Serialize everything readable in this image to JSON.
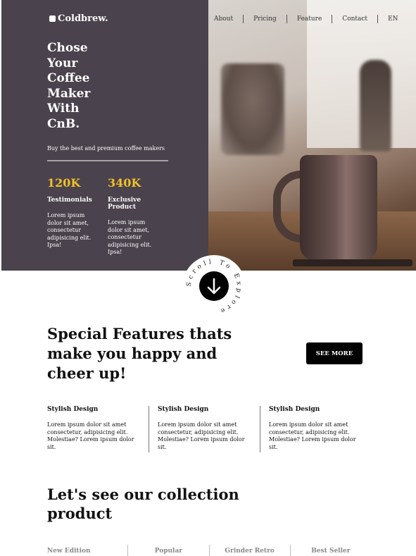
{
  "brand": {
    "name": "Coldbrew."
  },
  "nav": [
    "About",
    "Pricing",
    "Feature",
    "Contact",
    "EN"
  ],
  "hero": {
    "title_lines": [
      "Chose",
      "Your",
      "Coffee",
      "Maker",
      "With",
      "CnB."
    ],
    "subtitle": "Buy the best and premium coffee makers",
    "stats": [
      {
        "value": "120K",
        "label": "Testimonials",
        "desc": "Lorem ipsum dolor sit amet, consectetur adipisicing elit. Ipsa!"
      },
      {
        "value": "340K",
        "label": "Exclusive Product",
        "desc": "Lorem ipsum dolor sit amet, consectetur adipisicing elit. Ipsa!"
      }
    ],
    "scroll_text": "Scroll To Explore"
  },
  "features": {
    "title": "Special Features thats make you happy and cheer up!",
    "button": "SEE MORE",
    "items": [
      {
        "title": "Stylish Design",
        "desc": "Lorem ipsum dolor sit amet consectetur, adipisicing elit. Molestiae? Lorem ipsum dolor sit."
      },
      {
        "title": "Stylish Design",
        "desc": "Lorem ipsum dolor sit amet consectetur, adipisicing elit. Molestiae? Lorem ipsum dolor sit."
      },
      {
        "title": "Stylish Design",
        "desc": "Lorem ipsum dolor sit amet consectetur, adipisicing elit. Molestiae? Lorem ipsum dolor sit."
      }
    ]
  },
  "collection": {
    "title": "Let's see our collection product",
    "tabs": [
      "New Edition",
      "Popular",
      "Grinder Retro",
      "Best Seller"
    ]
  },
  "colors": {
    "hero_bg": "#4a424c",
    "accent": "#f2c22b",
    "button_bg": "#000000"
  },
  "icons": {
    "logo": "square-logo-icon",
    "scroll": "arrow-down-icon"
  }
}
